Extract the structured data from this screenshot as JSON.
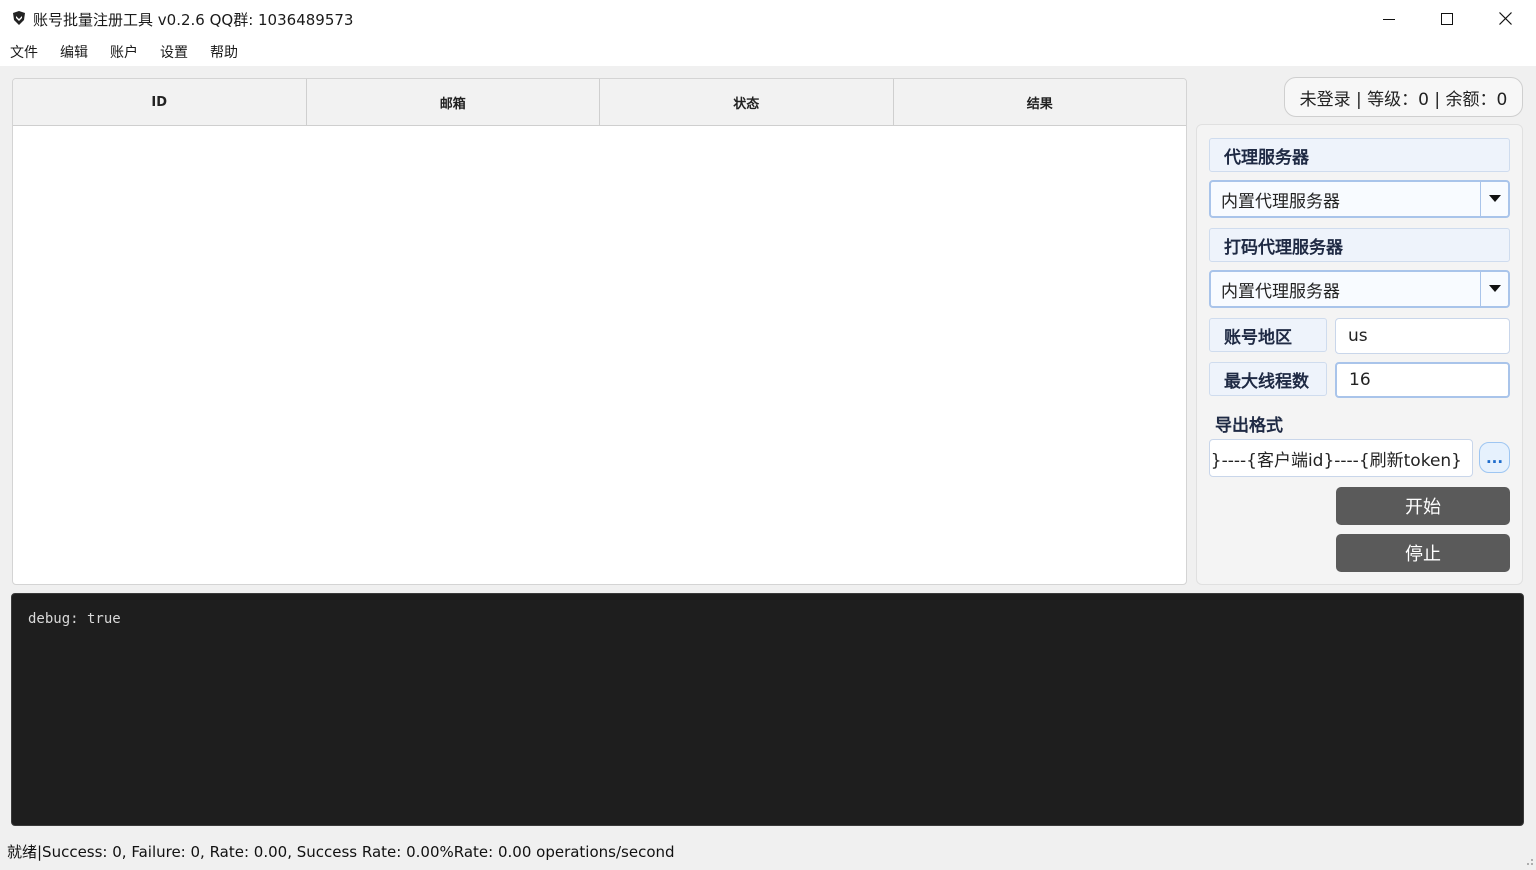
{
  "window": {
    "title": "账号批量注册工具 v0.2.6 QQ群: 1036489573"
  },
  "menu": {
    "items": [
      "文件",
      "编辑",
      "账户",
      "设置",
      "帮助"
    ]
  },
  "table": {
    "columns": [
      "ID",
      "邮箱",
      "状态",
      "结果"
    ],
    "rows": []
  },
  "account_status": "未登录 | 等级：0 | 余额：0",
  "settings": {
    "proxy_label": "代理服务器",
    "proxy_value": "内置代理服务器",
    "captcha_proxy_label": "打码代理服务器",
    "captcha_proxy_value": "内置代理服务器",
    "region_label": "账号地区",
    "region_value": "us",
    "threads_label": "最大线程数",
    "threads_value": "16",
    "export_label": "导出格式",
    "export_value": "}----{客户端id}----{刷新token}",
    "browse_label": "...",
    "start_label": "开始",
    "stop_label": "停止"
  },
  "console": {
    "lines": [
      "debug: true"
    ]
  },
  "status_bar": "就绪|Success: 0, Failure: 0, Rate: 0.00, Success Rate: 0.00%Rate: 0.00 operations/second",
  "icons": {
    "app": "shield-icon",
    "minimize": "minimize-icon",
    "maximize": "maximize-icon",
    "close": "close-icon",
    "dropdown": "caret-down-icon",
    "resize": "resize-grip-icon"
  },
  "colors": {
    "action_button": "#5a5a5a",
    "label_bg": "#eef3fb",
    "console_bg": "#1e1e1e",
    "accent_blue": "#1e6ccc"
  }
}
